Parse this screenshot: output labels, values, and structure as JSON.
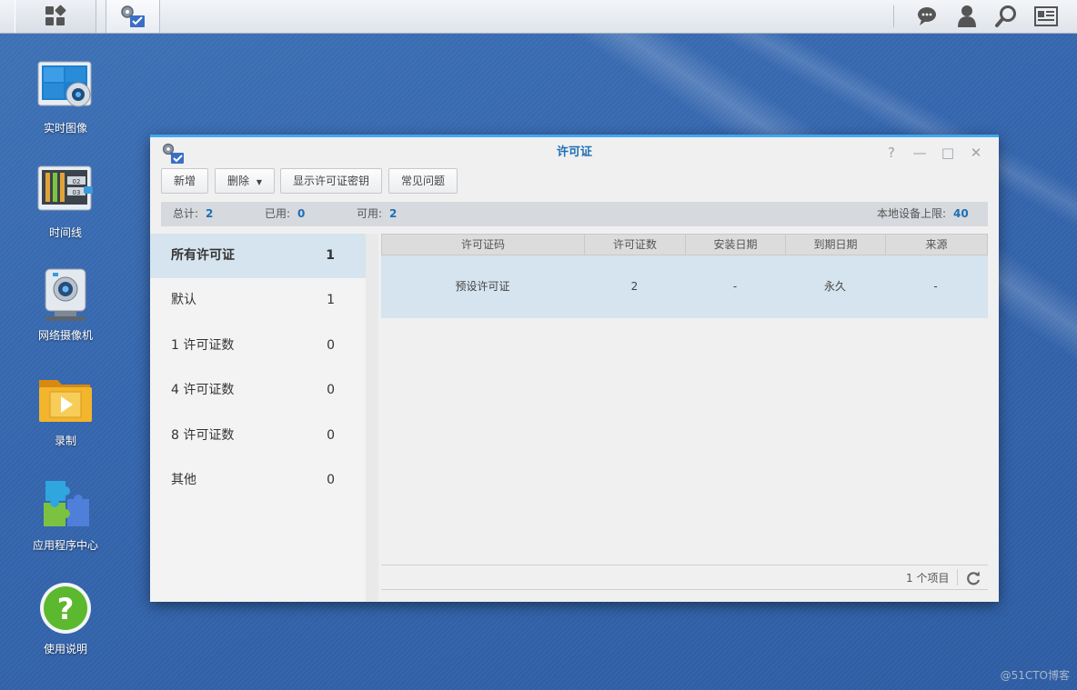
{
  "desktop": {
    "icons": [
      {
        "label": "实时图像"
      },
      {
        "label": "时间线"
      },
      {
        "label": "网络摄像机"
      },
      {
        "label": "录制"
      },
      {
        "label": "应用程序中心"
      },
      {
        "label": "使用说明"
      }
    ],
    "timeline_icon_labels": [
      "02",
      "03"
    ],
    "watermark": "@51CTO博客"
  },
  "window": {
    "title": "许可证",
    "controls": {
      "help": "?",
      "minimize": "—",
      "maximize": "□",
      "close": "✕"
    },
    "toolbar": {
      "add": "新增",
      "delete": "删除",
      "show_key": "显示许可证密钥",
      "faq": "常见问题"
    },
    "stats": {
      "total_label": "总计:",
      "total": "2",
      "used_label": "已用:",
      "used": "0",
      "available_label": "可用:",
      "available": "2",
      "limit_label": "本地设备上限:",
      "limit": "40"
    },
    "categories": [
      {
        "name": "所有许可证",
        "count": "1"
      },
      {
        "name": "默认",
        "count": "1"
      },
      {
        "name": "1 许可证数",
        "count": "0"
      },
      {
        "name": "4 许可证数",
        "count": "0"
      },
      {
        "name": "8 许可证数",
        "count": "0"
      },
      {
        "name": "其他",
        "count": "0"
      }
    ],
    "table": {
      "headers": [
        "许可证码",
        "许可证数",
        "安装日期",
        "到期日期",
        "来源"
      ],
      "rows": [
        [
          "预设许可证",
          "2",
          "-",
          "永久",
          "-"
        ]
      ]
    },
    "footer": {
      "count": "1 个项目"
    }
  },
  "colors": {
    "accent": "#1f6fb4",
    "selected_row": "#d5e4ee",
    "window_top_border": "#41a7f0"
  }
}
